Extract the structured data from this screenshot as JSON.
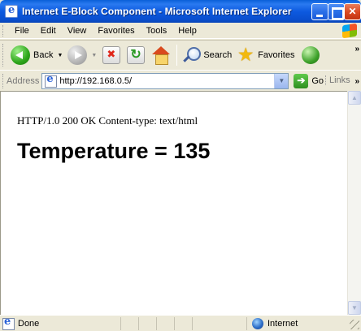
{
  "window": {
    "title": "Internet E-Block Component - Microsoft Internet Explorer"
  },
  "menubar": {
    "items": [
      "File",
      "Edit",
      "View",
      "Favorites",
      "Tools",
      "Help"
    ]
  },
  "toolbar": {
    "back_label": "Back",
    "search_label": "Search",
    "favorites_label": "Favorites"
  },
  "address_bar": {
    "label": "Address",
    "url": "http://192.168.0.5/",
    "go_label": "Go",
    "links_label": "Links"
  },
  "page": {
    "http_line": "HTTP/1.0 200 OK Content-type: text/html",
    "heading": "Temperature = 135"
  },
  "status_bar": {
    "status_text": "Done",
    "zone_text": "Internet"
  },
  "colors": {
    "titlebar": "#0a5fd8",
    "chrome": "#ece9d8",
    "close_button": "#d9471f"
  }
}
